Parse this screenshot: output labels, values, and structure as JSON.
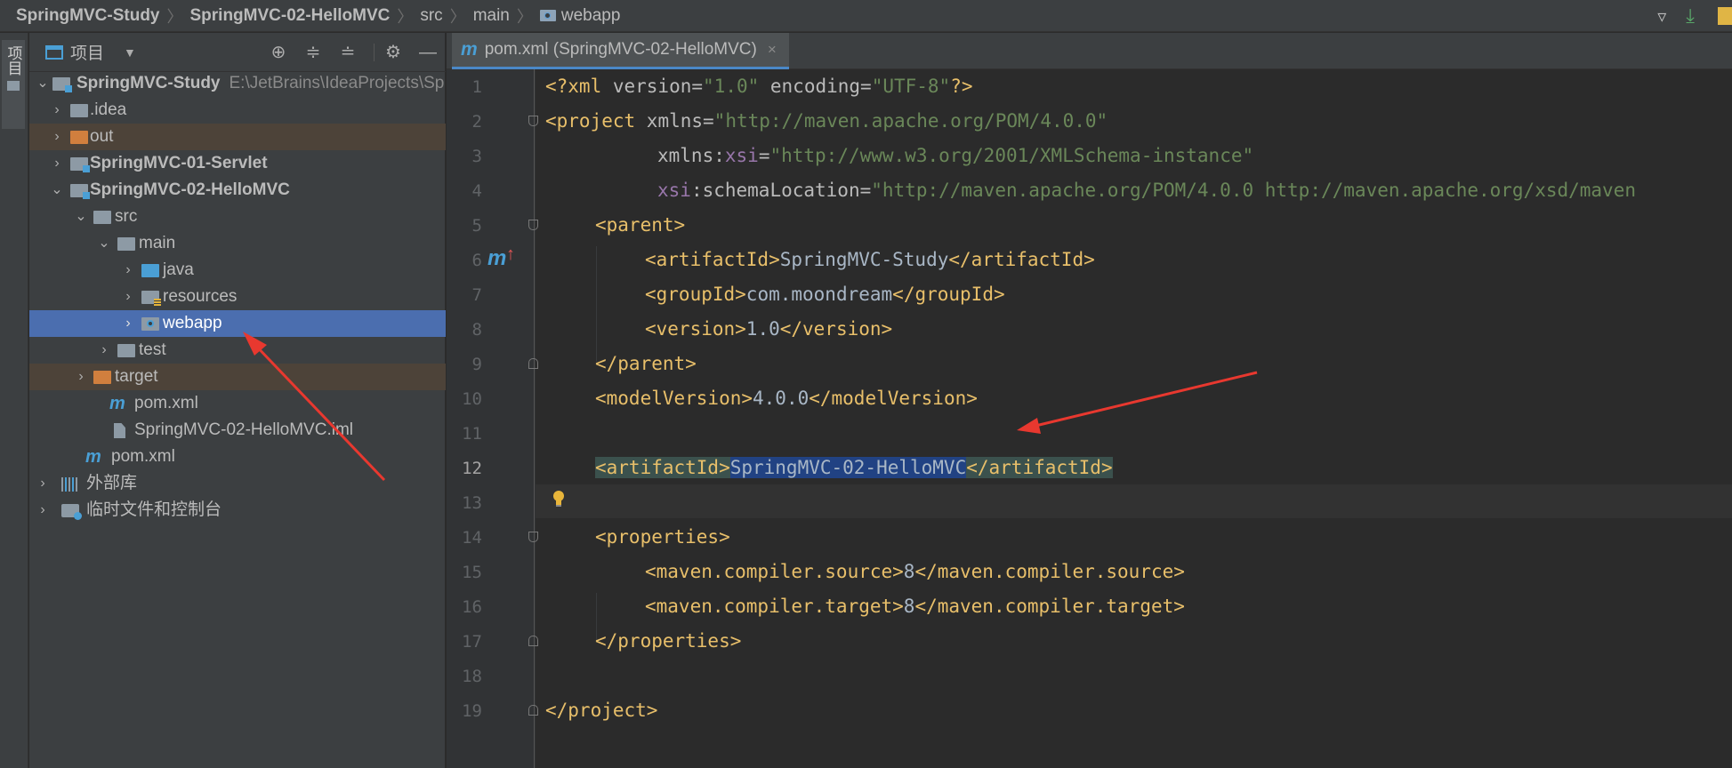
{
  "breadcrumb": {
    "items": [
      "SpringMVC-Study",
      "SpringMVC-02-HelloMVC",
      "src",
      "main",
      "webapp"
    ]
  },
  "side_strip": {
    "project_tab": "项目"
  },
  "project_panel": {
    "title": "项目",
    "icons": [
      "project-view-icon",
      "dropdown-icon",
      "locate-icon",
      "expand-all-icon",
      "collapse-all-icon",
      "gear-icon",
      "minimize-icon"
    ],
    "tree": [
      {
        "label": "SpringMVC-Study",
        "path": "E:\\JetBrains\\IdeaProjects\\Sp",
        "icon": "module-folder-icon",
        "expanded": true
      },
      {
        "label": ".idea",
        "icon": "folder-icon"
      },
      {
        "label": "out",
        "icon": "excluded-folder-icon"
      },
      {
        "label": "SpringMVC-01-Servlet",
        "icon": "module-folder-icon"
      },
      {
        "label": "SpringMVC-02-HelloMVC",
        "icon": "module-folder-icon",
        "expanded": true
      },
      {
        "label": "src",
        "icon": "folder-icon",
        "expanded": true
      },
      {
        "label": "main",
        "icon": "folder-icon",
        "expanded": true
      },
      {
        "label": "java",
        "icon": "source-folder-icon"
      },
      {
        "label": "resources",
        "icon": "resources-folder-icon"
      },
      {
        "label": "webapp",
        "icon": "web-folder-icon",
        "selected": true
      },
      {
        "label": "test",
        "icon": "folder-icon"
      },
      {
        "label": "target",
        "icon": "excluded-folder-icon"
      },
      {
        "label": "pom.xml",
        "icon": "maven-icon"
      },
      {
        "label": "SpringMVC-02-HelloMVC.iml",
        "icon": "file-icon"
      },
      {
        "label": "pom.xml",
        "icon": "maven-icon"
      },
      {
        "label": "外部库",
        "icon": "library-icon"
      },
      {
        "label": "临时文件和控制台",
        "icon": "scratch-icon"
      }
    ]
  },
  "editor": {
    "tab": {
      "label": "pom.xml (SpringMVC-02-HelloMVC)",
      "icon": "maven-icon",
      "close": "×"
    },
    "line_numbers": [
      "1",
      "2",
      "3",
      "4",
      "5",
      "6",
      "7",
      "8",
      "9",
      "10",
      "11",
      "12",
      "13",
      "14",
      "15",
      "16",
      "17",
      "18",
      "19"
    ],
    "current_line": "12",
    "code": {
      "l1": {
        "a": "<?xml ",
        "b": "version",
        "c": "=",
        "d": "\"1.0\"",
        "e": " encoding",
        "f": "=",
        "g": "\"UTF-8\"",
        "h": "?>"
      },
      "l2": {
        "a": "<project ",
        "b": "xmlns",
        "c": "=",
        "d": "\"http://maven.apache.org/POM/4.0.0\""
      },
      "l3": {
        "a": "xmlns",
        "b": ":",
        "c": "xsi",
        "d": "=",
        "e": "\"http://www.w3.org/2001/XMLSchema-instance\""
      },
      "l4": {
        "a": "xsi",
        "b": ":schemaLocation",
        "c": "=",
        "d": "\"http://maven.apache.org/POM/4.0.0 http://maven.apache.org/xsd/maven"
      },
      "l5": "<parent>",
      "l6": {
        "a": "<artifactId>",
        "b": "SpringMVC-Study",
        "c": "</artifactId>"
      },
      "l7": {
        "a": "<groupId>",
        "b": "com.moondream",
        "c": "</groupId>"
      },
      "l8": {
        "a": "<version>",
        "b": "1.0",
        "c": "</version>"
      },
      "l9": "</parent>",
      "l10": {
        "a": "<modelVersion>",
        "b": "4.0.0",
        "c": "</modelVersion>"
      },
      "l12": {
        "a": "<artifactId>",
        "b": "SpringMVC-02-HelloMVC",
        "c": "</artifactId>"
      },
      "l14": "<properties>",
      "l15": {
        "a": "<maven.compiler.source>",
        "b": "8",
        "c": "</maven.compiler.source>"
      },
      "l16": {
        "a": "<maven.compiler.target>",
        "b": "8",
        "c": "</maven.compiler.target>"
      },
      "l17": "</properties>",
      "l19": "</project>"
    },
    "gutter_marks": {
      "maven_m": "m",
      "up_arrow": "↑"
    }
  },
  "colors": {
    "selection": "#4b6eaf",
    "tag": "#e8bf6a",
    "string": "#6a8759",
    "namespace": "#9876aa",
    "annotation_arrow": "#e8382f"
  }
}
